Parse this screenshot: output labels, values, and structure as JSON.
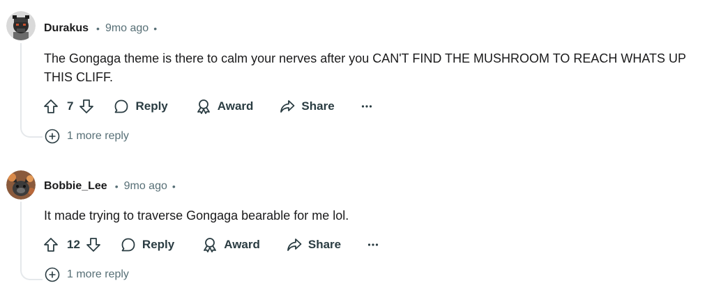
{
  "comments": [
    {
      "username": "Durakus",
      "separator": "•",
      "time": "9mo ago",
      "body": "The Gongaga theme is there to calm your nerves after you CAN'T FIND THE MUSHROOM TO REACH WHATS UP THIS CLIFF.",
      "votes": "7",
      "reply_label": "Reply",
      "award_label": "Award",
      "share_label": "Share",
      "more_label": "•••",
      "more_replies": "1 more reply"
    },
    {
      "username": "Bobbie_Lee",
      "separator": "•",
      "time": "9mo ago",
      "body": "It made trying to traverse Gongaga bearable for me lol.",
      "votes": "12",
      "reply_label": "Reply",
      "award_label": "Award",
      "share_label": "Share",
      "more_label": "•••",
      "more_replies": "1 more reply"
    }
  ],
  "colors": {
    "text_primary": "#1a1a1b",
    "text_secondary": "#576f76",
    "thread_line": "#e5e8eb"
  }
}
